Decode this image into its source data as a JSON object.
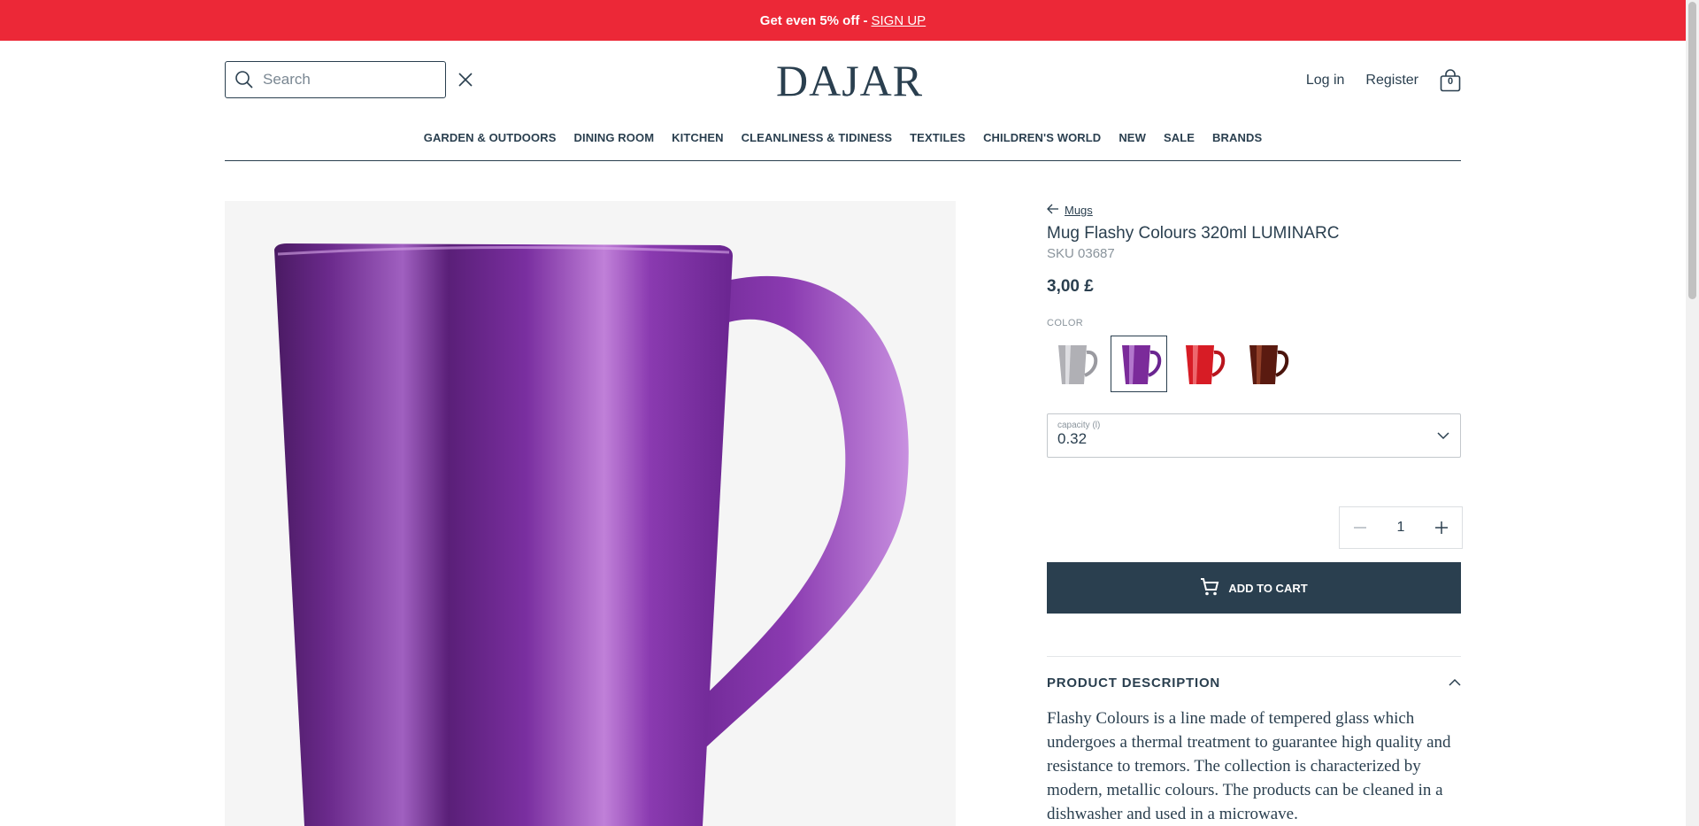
{
  "promo": {
    "text": "Get even 5% off - ",
    "link": "SIGN UP"
  },
  "header": {
    "search_placeholder": "Search",
    "logo": "DAJAR",
    "login": "Log in",
    "register": "Register",
    "cart_count": "0"
  },
  "nav": [
    "GARDEN & OUTDOORS",
    "DINING ROOM",
    "KITCHEN",
    "CLEANLINESS & TIDINESS",
    "TEXTILES",
    "CHILDREN'S WORLD",
    "NEW",
    "SALE",
    "BRANDS"
  ],
  "product": {
    "breadcrumb": "Mugs",
    "title": "Mug Flashy Colours 320ml LUMINARC",
    "sku": "SKU 03687",
    "price": "3,00 £",
    "color_label": "COLOR",
    "colors": [
      {
        "name": "silver",
        "hex": "#a9a9ad"
      },
      {
        "name": "purple",
        "hex": "#7b2b9a"
      },
      {
        "name": "red",
        "hex": "#d71c25"
      },
      {
        "name": "brown",
        "hex": "#5a1a10"
      }
    ],
    "selected_color": "purple",
    "capacity_label": "capacity (l)",
    "capacity_value": "0.32",
    "quantity": "1",
    "add_to_cart": "ADD TO CART",
    "description_heading": "PRODUCT DESCRIPTION",
    "description": "Flashy Colours is a line made of tempered glass which undergoes a thermal treatment to guarantee high quality and resistance to tremors. The collection is characterized by modern, metallic colours. The products can be cleaned in a dishwasher and used in a microwave."
  },
  "colors": {
    "promo": "#ec2837",
    "primary": "#2a3f4f",
    "mug": "#7b2b9a"
  }
}
